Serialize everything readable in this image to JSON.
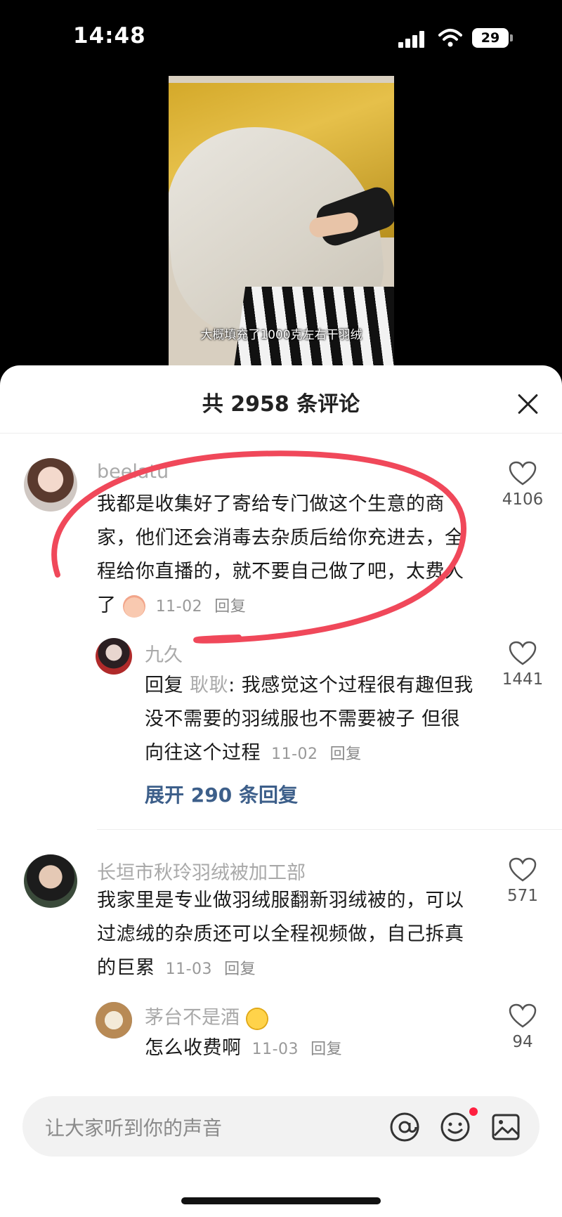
{
  "status": {
    "time": "14:48",
    "battery": "29"
  },
  "video": {
    "caption": "大概填充了1000克左右干羽绒"
  },
  "sheet": {
    "title": "共 2958 条评论"
  },
  "comments": [
    {
      "username": "beelatu",
      "text": "我都是收集好了寄给专门做这个生意的商家，他们还会消毒去杂质后给你充进去，全程给你直播的，就不要自己做了吧，太费人了",
      "date": "11-02",
      "reply_label": "回复",
      "likes": "4106",
      "replies": [
        {
          "username": "九久",
          "prefix": "回复",
          "mention": "耿耿",
          "text": ": 我感觉这个过程很有趣但我没不需要的羽绒服也不需要被子 但很向往这个过程",
          "date": "11-02",
          "reply_label": "回复",
          "likes": "1441"
        }
      ],
      "expand_label": "展开 290 条回复"
    },
    {
      "username": "长垣市秋玲羽绒被加工部",
      "text": "我家里是专业做羽绒服翻新羽绒被的，可以过滤绒的杂质还可以全程视频做，自己拆真的巨累",
      "date": "11-03",
      "reply_label": "回复",
      "likes": "571",
      "replies": [
        {
          "username": "茅台不是酒",
          "text": "怎么收费啊",
          "date": "11-03",
          "reply_label": "回复",
          "likes": "94"
        }
      ]
    }
  ],
  "input": {
    "placeholder": "让大家听到你的声音"
  },
  "icons": {
    "signal": "signal-icon",
    "wifi": "wifi-icon",
    "close": "close-icon",
    "like": "heart-icon",
    "mention": "at-icon",
    "emoji": "smiley-icon",
    "image": "image-icon"
  },
  "colors": {
    "mention_text": "#3d5f8a",
    "annotation_circle": "#f0485a"
  }
}
